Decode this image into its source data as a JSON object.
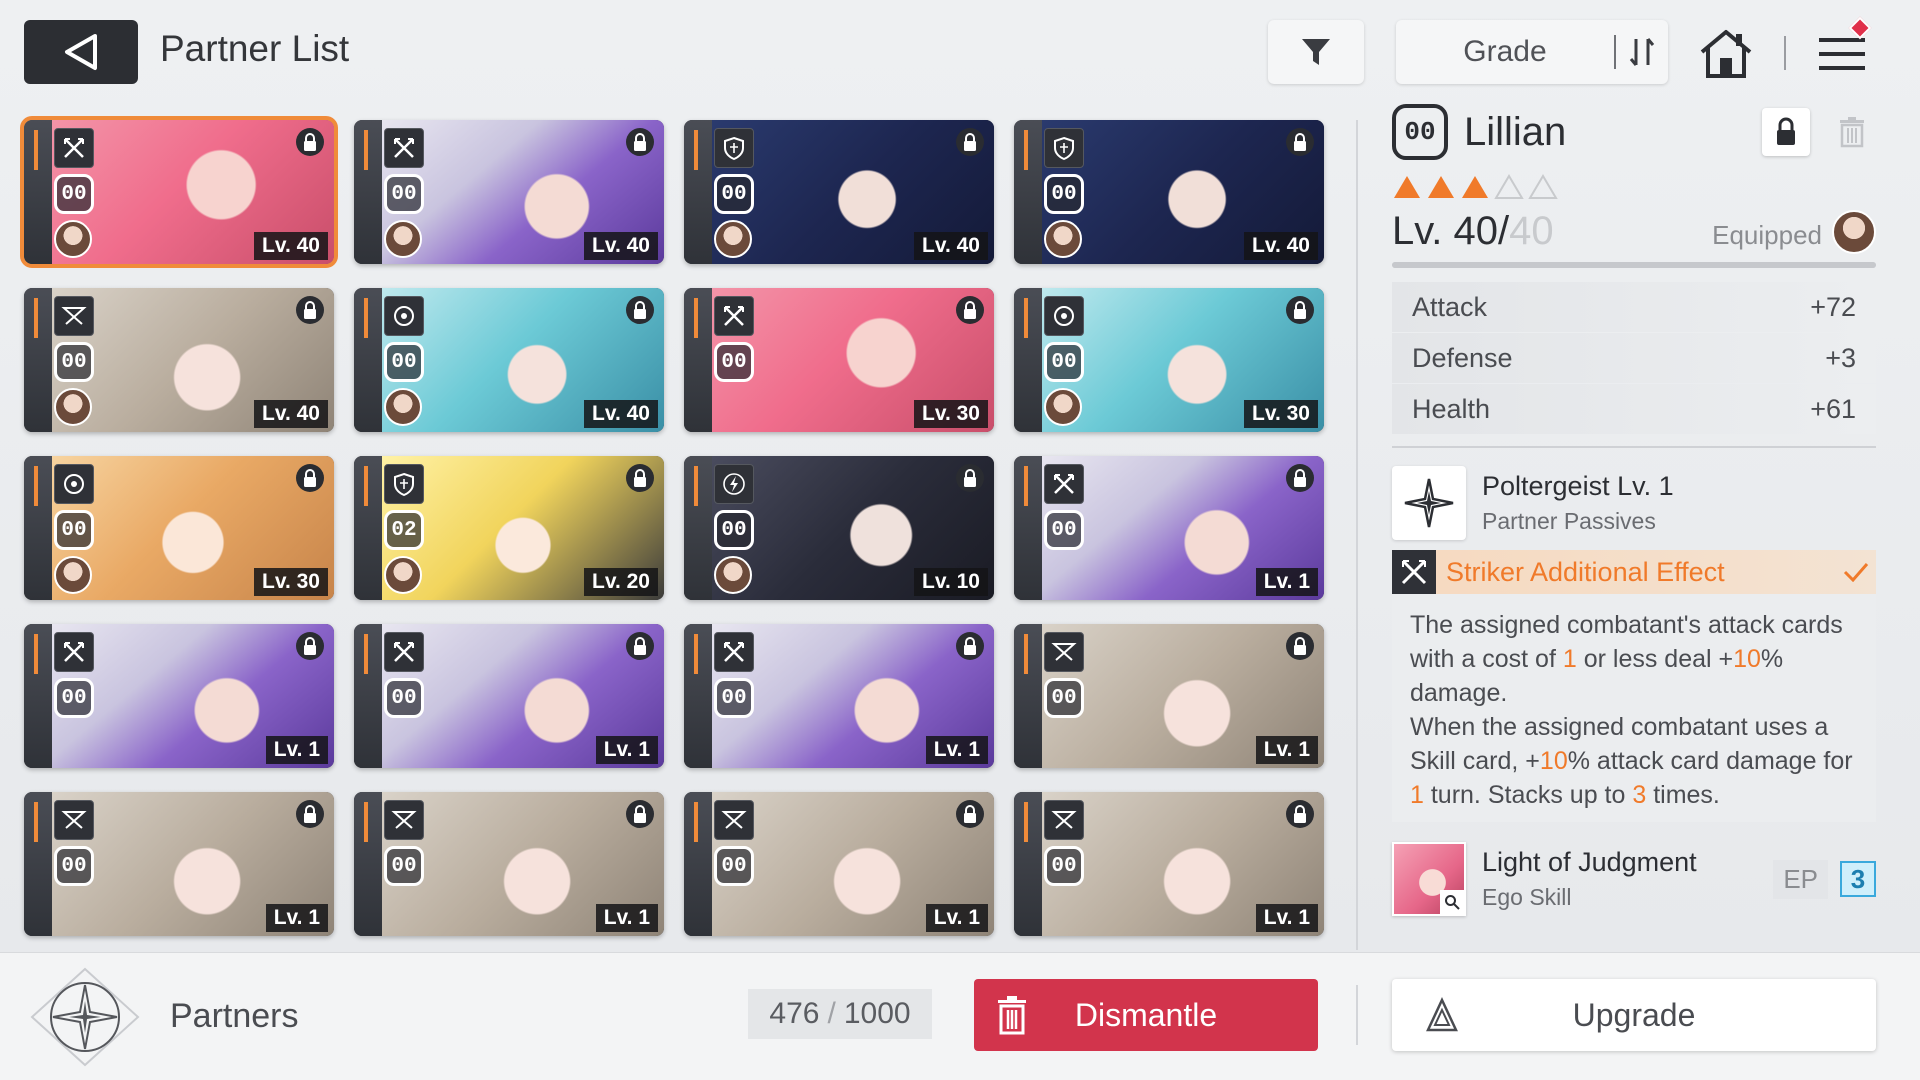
{
  "header": {
    "title": "Partner List",
    "sort_label": "Grade"
  },
  "partners": [
    {
      "level": "Lv. 40",
      "grade": "00",
      "art": "pink",
      "class_icon": "striker-icon",
      "avatar": true,
      "selected": true
    },
    {
      "level": "Lv. 40",
      "grade": "00",
      "art": "purple",
      "class_icon": "striker-icon",
      "avatar": true
    },
    {
      "level": "Lv. 40",
      "grade": "00",
      "art": "navy",
      "class_icon": "shield-icon",
      "avatar": true
    },
    {
      "level": "Lv. 40",
      "grade": "00",
      "art": "navy",
      "class_icon": "shield-icon",
      "avatar": true
    },
    {
      "level": "Lv. 40",
      "grade": "00",
      "art": "silver",
      "class_icon": "ranger-icon",
      "avatar": true
    },
    {
      "level": "Lv. 40",
      "grade": "00",
      "art": "teal",
      "class_icon": "target-icon",
      "avatar": true
    },
    {
      "level": "Lv. 30",
      "grade": "00",
      "art": "pink",
      "class_icon": "striker-icon",
      "avatar": false
    },
    {
      "level": "Lv. 30",
      "grade": "00",
      "art": "teal",
      "class_icon": "target-icon",
      "avatar": true
    },
    {
      "level": "Lv. 30",
      "grade": "00",
      "art": "ginger",
      "class_icon": "target-icon",
      "avatar": true
    },
    {
      "level": "Lv. 20",
      "grade": "02",
      "art": "blonde",
      "class_icon": "shield-icon",
      "avatar": true
    },
    {
      "level": "Lv. 10",
      "grade": "00",
      "art": "dark",
      "class_icon": "lightning-icon",
      "avatar": true
    },
    {
      "level": "Lv. 1",
      "grade": "00",
      "art": "purple",
      "class_icon": "striker-icon",
      "avatar": false
    },
    {
      "level": "Lv. 1",
      "grade": "00",
      "art": "purple",
      "class_icon": "striker-icon",
      "avatar": false
    },
    {
      "level": "Lv. 1",
      "grade": "00",
      "art": "purple",
      "class_icon": "striker-icon",
      "avatar": false
    },
    {
      "level": "Lv. 1",
      "grade": "00",
      "art": "purple",
      "class_icon": "striker-icon",
      "avatar": false
    },
    {
      "level": "Lv. 1",
      "grade": "00",
      "art": "silver",
      "class_icon": "ranger-icon",
      "avatar": false
    },
    {
      "level": "Lv. 1",
      "grade": "00",
      "art": "silver",
      "class_icon": "ranger-icon",
      "avatar": false
    },
    {
      "level": "Lv. 1",
      "grade": "00",
      "art": "silver",
      "class_icon": "ranger-icon",
      "avatar": false
    },
    {
      "level": "Lv. 1",
      "grade": "00",
      "art": "silver",
      "class_icon": "ranger-icon",
      "avatar": false
    },
    {
      "level": "Lv. 1",
      "grade": "00",
      "art": "silver",
      "class_icon": "ranger-icon",
      "avatar": false
    }
  ],
  "detail": {
    "grade": "00",
    "name": "Lillian",
    "stars_filled": 3,
    "stars_total": 5,
    "level_current": "Lv. 40/",
    "level_max": "40",
    "level_progress": 1.0,
    "equipped_label": "Equipped",
    "stats": [
      {
        "label": "Attack",
        "value": "+72"
      },
      {
        "label": "Defense",
        "value": "+3"
      },
      {
        "label": "Health",
        "value": "+61"
      }
    ],
    "passive": {
      "name": "Poltergeist Lv. 1",
      "sub": "Partner Passives"
    },
    "effect_title": "Striker Additional Effect",
    "effect_desc": {
      "p1": "The assigned combatant's attack cards with a cost of ",
      "n1": "1",
      "p2": " or less deal +",
      "n2": "10",
      "p3": "% damage.",
      "p4": "When the assigned combatant uses a Skill card, +",
      "n3": "10",
      "p5": "% attack card damage for ",
      "n4": "1",
      "p6": " turn. Stacks up to ",
      "n5": "3",
      "p7": " times."
    },
    "ego": {
      "name": "Light of Judgment",
      "sub": "Ego Skill",
      "ep_label": "EP",
      "ep_value": "3"
    }
  },
  "footer": {
    "partners_label": "Partners",
    "count_current": "476",
    "count_sep": "/",
    "count_max": "1000",
    "dismantle_label": "Dismantle",
    "upgrade_label": "Upgrade"
  },
  "colors": {
    "accent": "#f07a2a",
    "dismantle": "#d2344c",
    "ep": "#3aa9dc"
  }
}
